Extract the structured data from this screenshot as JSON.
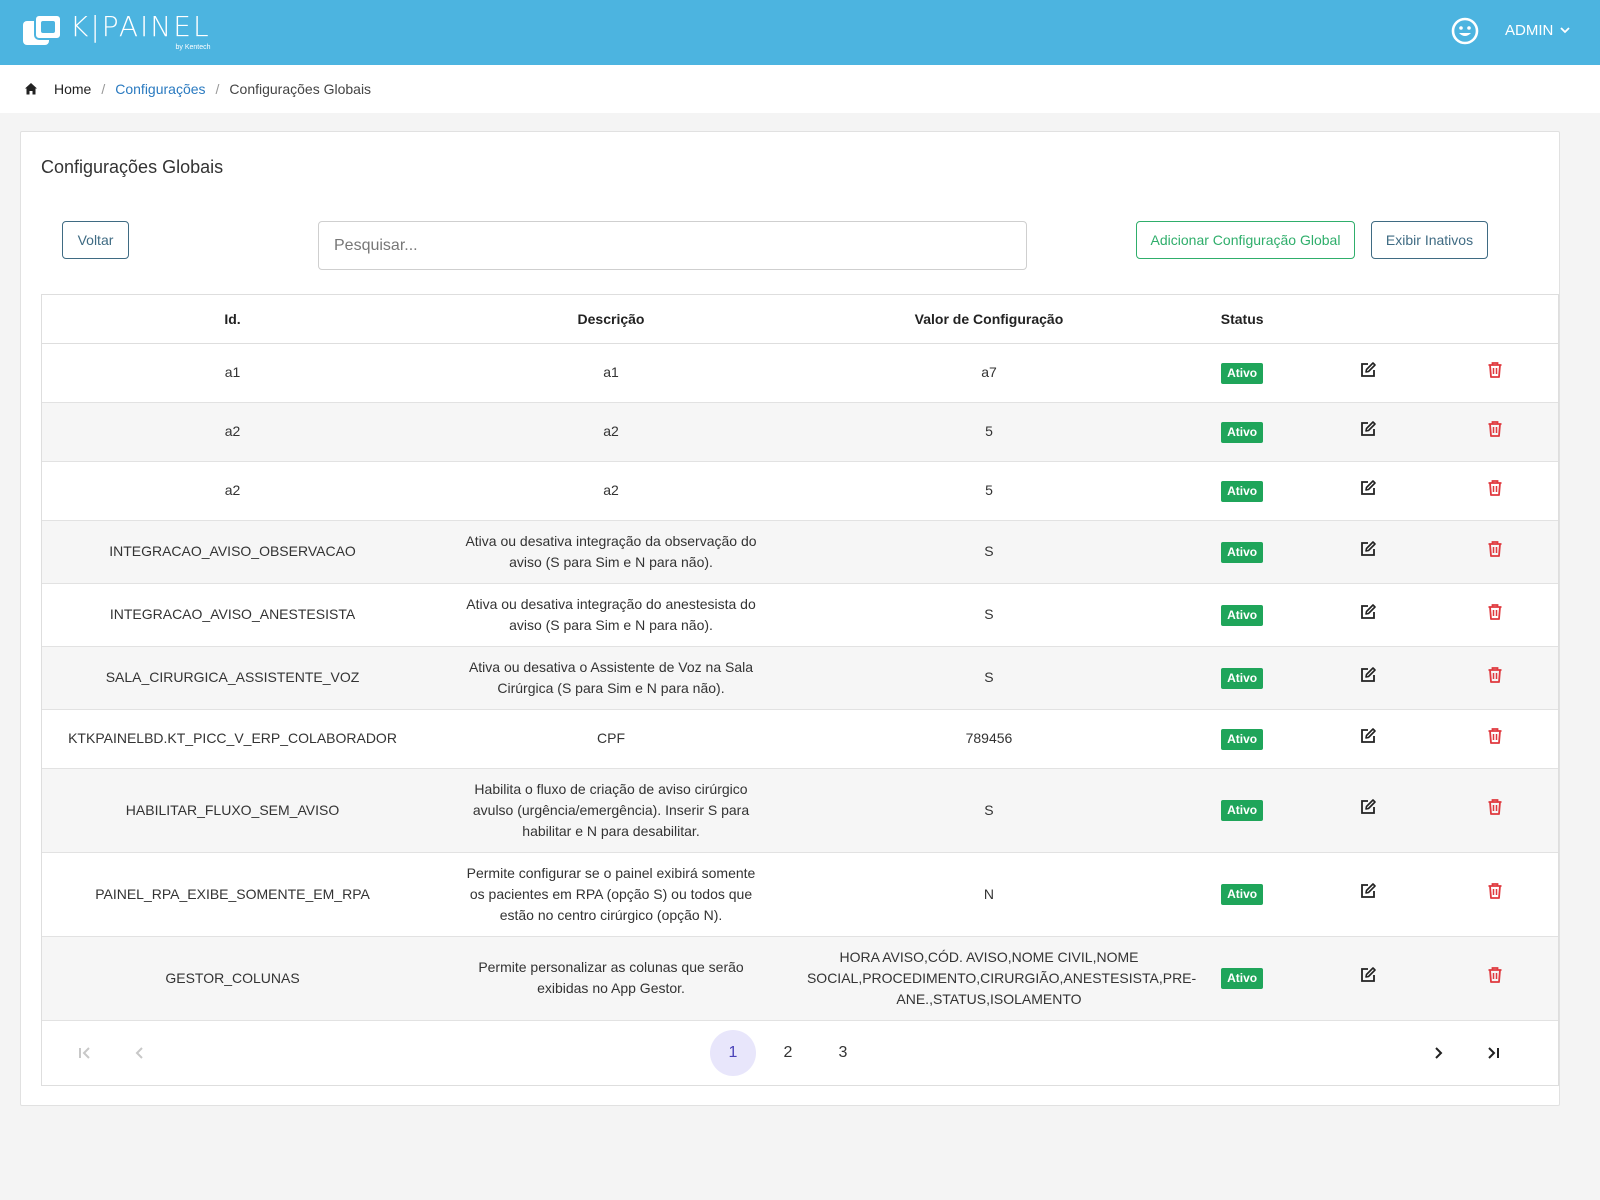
{
  "header": {
    "logo_text": "K|PAINEL",
    "logo_sub": "by Kentech",
    "user_label": "ADMIN"
  },
  "breadcrumb": {
    "home": "Home",
    "section": "Configurações",
    "current": "Configurações Globais",
    "separator": "/"
  },
  "page": {
    "title": "Configurações Globais",
    "back_label": "Voltar",
    "search_placeholder": "Pesquisar...",
    "add_label": "Adicionar Configuração Global",
    "inactive_label": "Exibir Inativos"
  },
  "table": {
    "columns": [
      "Id.",
      "Descrição",
      "Valor de Configuração",
      "Status",
      "",
      ""
    ],
    "rows": [
      {
        "id": "a1",
        "descricao": "a1",
        "valor": "a7",
        "status": "Ativo"
      },
      {
        "id": "a2",
        "descricao": "a2",
        "valor": "5",
        "status": "Ativo"
      },
      {
        "id": "a2",
        "descricao": "a2",
        "valor": "5",
        "status": "Ativo"
      },
      {
        "id": "INTEGRACAO_AVISO_OBSERVACAO",
        "descricao": "Ativa ou desativa integração da observação do aviso (S para Sim e N para não).",
        "valor": "S",
        "status": "Ativo"
      },
      {
        "id": "INTEGRACAO_AVISO_ANESTESISTA",
        "descricao": "Ativa ou desativa integração do anestesista do aviso (S para Sim e N para não).",
        "valor": "S",
        "status": "Ativo"
      },
      {
        "id": "SALA_CIRURGICA_ASSISTENTE_VOZ",
        "descricao": "Ativa ou desativa o Assistente de Voz na Sala Cirúrgica (S para Sim e N para não).",
        "valor": "S",
        "status": "Ativo"
      },
      {
        "id": "KTKPAINELBD.KT_PICC_V_ERP_COLABORADOR",
        "descricao": "CPF",
        "valor": "789456",
        "status": "Ativo"
      },
      {
        "id": "HABILITAR_FLUXO_SEM_AVISO",
        "descricao": "Habilita o fluxo de criação de aviso cirúrgico avulso (urgência/emergência). Inserir S para habilitar e N para desabilitar.",
        "valor": "S",
        "status": "Ativo"
      },
      {
        "id": "PAINEL_RPA_EXIBE_SOMENTE_EM_RPA",
        "descricao": "Permite configurar se o painel exibirá somente os pacientes em RPA (opção S) ou todos que estão no centro cirúrgico (opção N).",
        "valor": "N",
        "status": "Ativo"
      },
      {
        "id": "GESTOR_COLUNAS",
        "descricao": "Permite personalizar as colunas que serão exibidas no App Gestor.",
        "valor": "HORA AVISO,CÓD. AVISO,NOME CIVIL,NOME SOCIAL,PROCEDIMENTO,CIRURGIÃO,ANESTESISTA,PRE-ANE.,STATUS,ISOLAMENTO",
        "status": "Ativo"
      }
    ]
  },
  "pagination": {
    "pages": [
      "1",
      "2",
      "3"
    ],
    "current": "1"
  },
  "colors": {
    "topbar": "#4cb4e0",
    "active_badge": "#1fa55a",
    "delete_icon": "#e0393e",
    "link": "#2a7ac0"
  }
}
